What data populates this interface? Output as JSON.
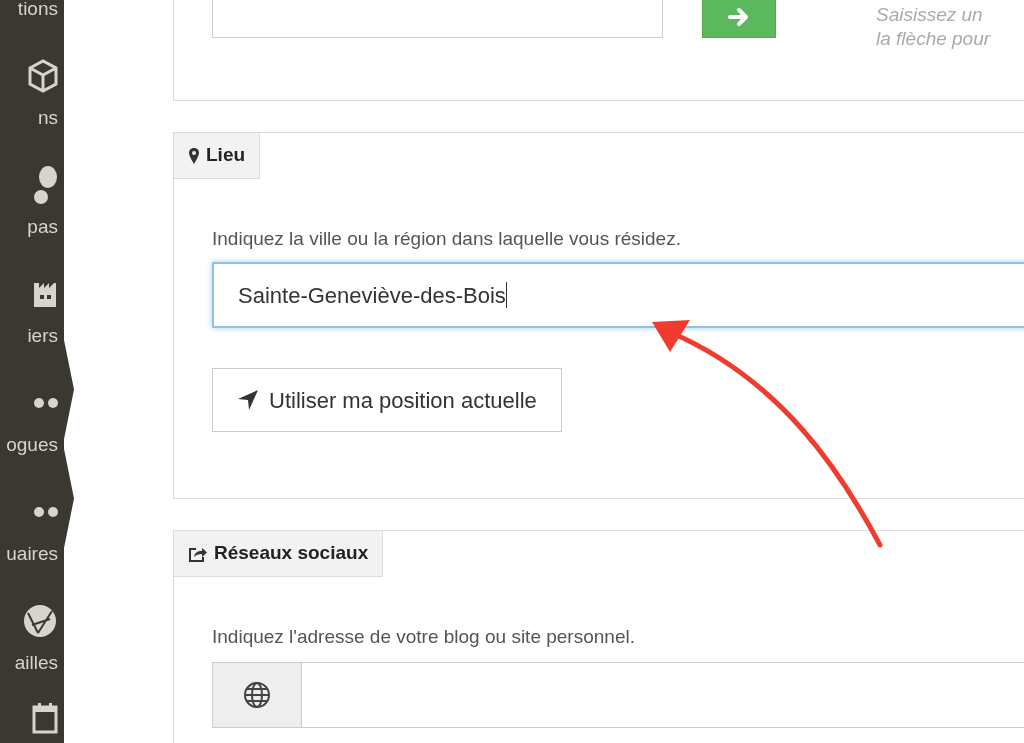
{
  "sidebar": {
    "items": [
      {
        "label": "tions",
        "selected": false
      },
      {
        "label": "ns",
        "selected": false
      },
      {
        "label": "pas",
        "selected": false
      },
      {
        "label": "iers",
        "selected": false
      },
      {
        "label": "ogues",
        "selected": true
      },
      {
        "label": "uaires",
        "selected": true
      },
      {
        "label": "ailles",
        "selected": false
      },
      {
        "selected": false
      }
    ]
  },
  "top_panel": {
    "hint_lines": [
      "Saisissez un",
      "la flèche pour"
    ]
  },
  "sections": [
    {
      "kind": "location",
      "title": "Lieu",
      "description": "Indiquez la ville ou la région dans laquelle vous résidez.",
      "value": "Sainte-Geneviève-des-Bois",
      "focused": true,
      "button": "Utiliser ma position actuelle"
    },
    {
      "kind": "social",
      "title": "Réseaux sociaux",
      "description": "Indiquez l'adresse de votre blog ou site personnel."
    }
  ]
}
